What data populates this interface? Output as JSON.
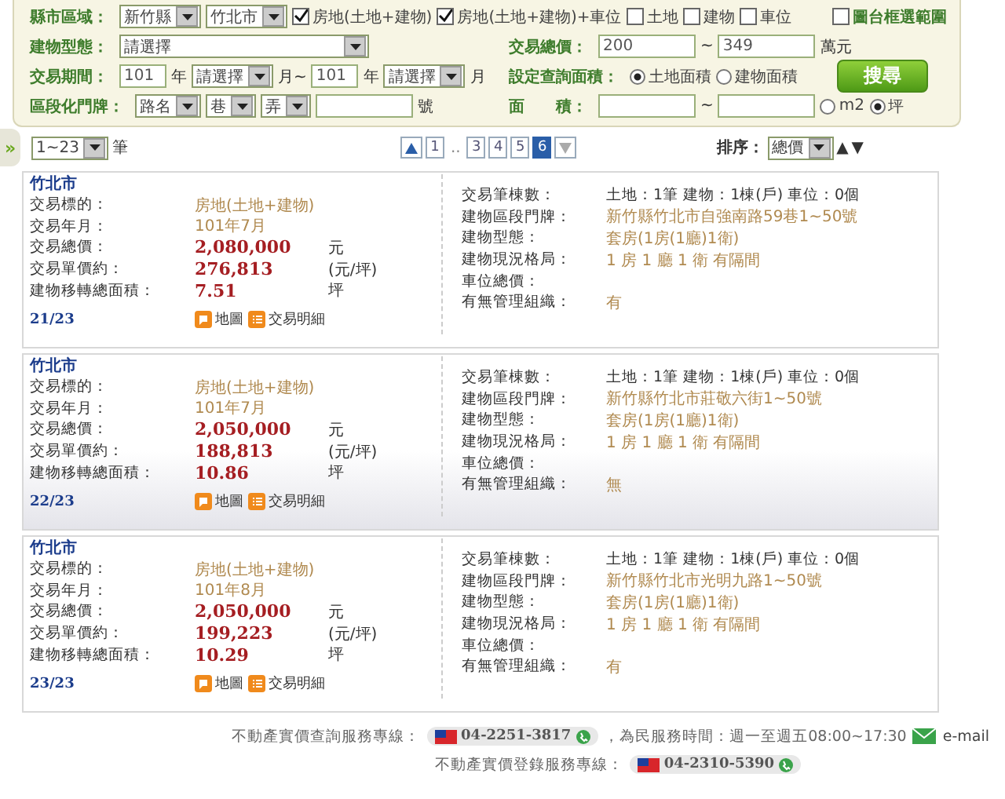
{
  "search_form": {
    "rows": [
      {
        "left": [
          {
            "kind": "label",
            "text": "縣市區域："
          },
          {
            "kind": "select",
            "value": "新竹縣"
          },
          {
            "kind": "select",
            "value": "竹北市"
          },
          {
            "kind": "checkbox",
            "label": "房地(土地+建物)",
            "checked": true
          },
          {
            "kind": "checkbox",
            "label": "房地(土地+建物)+車位",
            "checked": true
          },
          {
            "kind": "checkbox",
            "label": "土地",
            "checked": false
          },
          {
            "kind": "checkbox",
            "label": "建物",
            "checked": false
          },
          {
            "kind": "checkbox",
            "label": "車位",
            "checked": false
          }
        ],
        "right": [],
        "end": [
          {
            "kind": "checkbox",
            "label": "圖台框選範圍",
            "checked": false
          }
        ]
      },
      {
        "left": [
          {
            "kind": "label",
            "text": "建物型態："
          },
          {
            "kind": "select",
            "value": "請選擇"
          }
        ],
        "right": [
          {
            "kind": "label",
            "text": "交易總價："
          },
          {
            "kind": "input",
            "value": "200"
          },
          {
            "kind": "text",
            "text": "~"
          },
          {
            "kind": "input",
            "value": "349"
          },
          {
            "kind": "text",
            "text": "萬元"
          }
        ],
        "end": []
      },
      {
        "left": [
          {
            "kind": "label",
            "text": "交易期間："
          },
          {
            "kind": "input",
            "value": "101"
          },
          {
            "kind": "text",
            "text": "年"
          },
          {
            "kind": "select",
            "value": "請選擇"
          },
          {
            "kind": "text",
            "text": "月~"
          },
          {
            "kind": "input",
            "value": "101"
          },
          {
            "kind": "text",
            "text": "年"
          },
          {
            "kind": "select",
            "value": "請選擇"
          },
          {
            "kind": "text",
            "text": "月"
          }
        ],
        "right": [
          {
            "kind": "label",
            "text": "設定查詢面積："
          },
          {
            "kind": "radio",
            "label": "土地面積",
            "selected": true
          },
          {
            "kind": "radio",
            "label": "建物面積",
            "selected": false
          }
        ],
        "end": [
          {
            "kind": "button",
            "text": "搜尋"
          }
        ]
      },
      {
        "left": [
          {
            "kind": "label",
            "text": "區段化門牌："
          },
          {
            "kind": "select",
            "value": "路名"
          },
          {
            "kind": "select",
            "value": "巷"
          },
          {
            "kind": "select",
            "value": "弄"
          },
          {
            "kind": "input"
          },
          {
            "kind": "text",
            "text": "號"
          }
        ],
        "right": [
          {
            "kind": "label",
            "text": "面　　積："
          },
          {
            "kind": "input"
          },
          {
            "kind": "text",
            "text": "~"
          },
          {
            "kind": "input"
          },
          {
            "kind": "radio",
            "label": "m2",
            "selected": false
          },
          {
            "kind": "radio",
            "label": "坪",
            "selected": true
          }
        ],
        "end": []
      }
    ]
  },
  "side_tab": "»",
  "toolbar": {
    "page_size": "1~23",
    "page_size_unit": "筆",
    "pages": [
      {
        "kind": "first"
      },
      {
        "kind": "page",
        "label": "1",
        "selected": false
      },
      {
        "kind": "gap",
        "label": ".."
      },
      {
        "kind": "page",
        "label": "3",
        "selected": false
      },
      {
        "kind": "page",
        "label": "4",
        "selected": false
      },
      {
        "kind": "page",
        "label": "5",
        "selected": false
      },
      {
        "kind": "page",
        "label": "6",
        "selected": true
      },
      {
        "kind": "last"
      }
    ],
    "sort_label": "排序：",
    "sort_value": "總價",
    "sort_up": "▲",
    "sort_down": "▼"
  },
  "results": [
    {
      "selected": false,
      "city": "竹北市",
      "index": "21/23",
      "actions": [
        "地圖",
        "交易明細"
      ],
      "left": [
        {
          "kind": "text",
          "label": "交易標的：",
          "value": "房地(土地+建物)"
        },
        {
          "kind": "text",
          "label": "交易年月：",
          "value": "101年7月"
        },
        {
          "kind": "amount",
          "label": "交易總價：",
          "value": "2,080,000",
          "unit": "元"
        },
        {
          "kind": "amount",
          "label": "交易單價約：",
          "value": "276,813",
          "unit": "(元/坪)"
        },
        {
          "kind": "amount",
          "label": "建物移轉總面積：",
          "value": "7.51",
          "unit": "坪"
        }
      ],
      "right": [
        {
          "kind": "count",
          "label": "交易筆棟數：",
          "value": "土地：1筆 建物：1棟(戶) 車位：0個"
        },
        {
          "kind": "text",
          "label": "建物區段門牌：",
          "value": "新竹縣竹北市自強南路59巷1~50號"
        },
        {
          "kind": "text",
          "label": "建物型態：",
          "value": "套房(1房(1廳)1衛)"
        },
        {
          "kind": "text",
          "label": "建物現況格局：",
          "value": "1 房 1 廳 1 衛 有隔間"
        },
        {
          "label": "車位總價："
        },
        {
          "kind": "text",
          "label": "有無管理組織：",
          "value": "有"
        }
      ]
    },
    {
      "selected": true,
      "city": "竹北市",
      "index": "22/23",
      "actions": [
        "地圖",
        "交易明細"
      ],
      "left": [
        {
          "kind": "text",
          "label": "交易標的：",
          "value": "房地(土地+建物)"
        },
        {
          "kind": "text",
          "label": "交易年月：",
          "value": "101年7月"
        },
        {
          "kind": "amount",
          "label": "交易總價：",
          "value": "2,050,000",
          "unit": "元"
        },
        {
          "kind": "amount",
          "label": "交易單價約：",
          "value": "188,813",
          "unit": "(元/坪)"
        },
        {
          "kind": "amount",
          "label": "建物移轉總面積：",
          "value": "10.86",
          "unit": "坪"
        }
      ],
      "right": [
        {
          "kind": "count",
          "label": "交易筆棟數：",
          "value": "土地：1筆 建物：1棟(戶) 車位：0個"
        },
        {
          "kind": "text",
          "label": "建物區段門牌：",
          "value": "新竹縣竹北市莊敬六街1~50號"
        },
        {
          "kind": "text",
          "label": "建物型態：",
          "value": "套房(1房(1廳)1衛)"
        },
        {
          "kind": "text",
          "label": "建物現況格局：",
          "value": "1 房 1 廳 1 衛 有隔間"
        },
        {
          "label": "車位總價："
        },
        {
          "kind": "text",
          "label": "有無管理組織：",
          "value": "無"
        }
      ]
    },
    {
      "selected": false,
      "city": "竹北市",
      "index": "23/23",
      "actions": [
        "地圖",
        "交易明細"
      ],
      "left": [
        {
          "kind": "text",
          "label": "交易標的：",
          "value": "房地(土地+建物)"
        },
        {
          "kind": "text",
          "label": "交易年月：",
          "value": "101年8月"
        },
        {
          "kind": "amount",
          "label": "交易總價：",
          "value": "2,050,000",
          "unit": "元"
        },
        {
          "kind": "amount",
          "label": "交易單價約：",
          "value": "199,223",
          "unit": "(元/坪)"
        },
        {
          "kind": "amount",
          "label": "建物移轉總面積：",
          "value": "10.29",
          "unit": "坪"
        }
      ],
      "right": [
        {
          "kind": "count",
          "label": "交易筆棟數：",
          "value": "土地：1筆 建物：1棟(戶) 車位：0個"
        },
        {
          "kind": "text",
          "label": "建物區段門牌：",
          "value": "新竹縣竹北市光明九路1~50號"
        },
        {
          "kind": "text",
          "label": "建物型態：",
          "value": "套房(1房(1廳)1衛)"
        },
        {
          "kind": "text",
          "label": "建物現況格局：",
          "value": "1 房 1 廳 1 衛 有隔間"
        },
        {
          "label": "車位總價："
        },
        {
          "kind": "text",
          "label": "有無管理組織：",
          "value": "有"
        }
      ]
    }
  ],
  "footer": [
    {
      "label": "不動產實價查詢服務專線：",
      "phone": "04-2251-3817",
      "hours": "，為民服務時間：週一至週五08:00~17:30",
      "email": "e-mail"
    },
    {
      "label": "不動產實價登錄服務專線：",
      "phone": "04-2310-5390"
    }
  ]
}
